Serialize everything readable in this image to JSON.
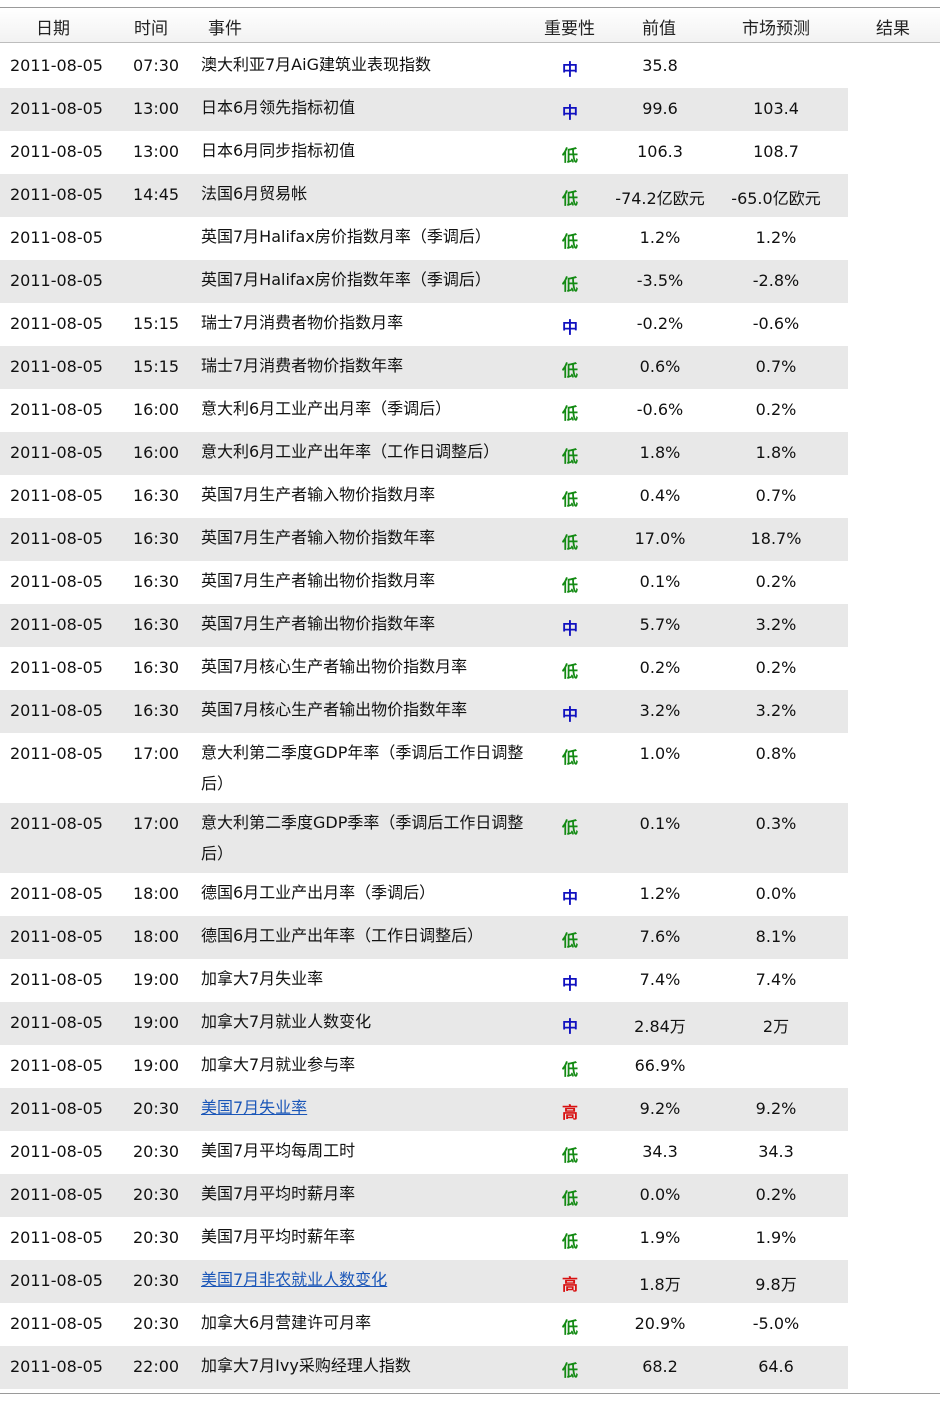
{
  "header": {
    "date": "日期",
    "time": "时间",
    "event": "事件",
    "importance": "重要性",
    "previous": "前值",
    "forecast": "市场预测",
    "result": "结果"
  },
  "colors": {
    "mid": "#1010c0",
    "low": "#138a13",
    "high": "#d81010",
    "link": "#1a56b8",
    "alt_row": "#e8e8e8"
  },
  "rows": [
    {
      "date": "2011-08-05",
      "time": "07:30",
      "event": "澳大利亚7月AiG建筑业表现指数",
      "importance": "中",
      "previous": "35.8",
      "forecast": ""
    },
    {
      "date": "2011-08-05",
      "time": "13:00",
      "event": "日本6月领先指标初值",
      "importance": "中",
      "previous": "99.6",
      "forecast": "103.4"
    },
    {
      "date": "2011-08-05",
      "time": "13:00",
      "event": "日本6月同步指标初值",
      "importance": "低",
      "previous": "106.3",
      "forecast": "108.7"
    },
    {
      "date": "2011-08-05",
      "time": "14:45",
      "event": "法国6月贸易帐",
      "importance": "低",
      "previous": "-74.2亿欧元",
      "forecast": "-65.0亿欧元"
    },
    {
      "date": "2011-08-05",
      "time": "",
      "event": "英国7月Halifax房价指数月率（季调后）",
      "importance": "低",
      "previous": "1.2%",
      "forecast": "1.2%"
    },
    {
      "date": "2011-08-05",
      "time": "",
      "event": "英国7月Halifax房价指数年率（季调后）",
      "importance": "低",
      "previous": "-3.5%",
      "forecast": "-2.8%"
    },
    {
      "date": "2011-08-05",
      "time": "15:15",
      "event": "瑞士7月消费者物价指数月率",
      "importance": "中",
      "previous": "-0.2%",
      "forecast": "-0.6%"
    },
    {
      "date": "2011-08-05",
      "time": "15:15",
      "event": "瑞士7月消费者物价指数年率",
      "importance": "低",
      "previous": "0.6%",
      "forecast": "0.7%"
    },
    {
      "date": "2011-08-05",
      "time": "16:00",
      "event": "意大利6月工业产出月率（季调后）",
      "importance": "低",
      "previous": "-0.6%",
      "forecast": "0.2%"
    },
    {
      "date": "2011-08-05",
      "time": "16:00",
      "event": "意大利6月工业产出年率（工作日调整后）",
      "importance": "低",
      "previous": "1.8%",
      "forecast": "1.8%"
    },
    {
      "date": "2011-08-05",
      "time": "16:30",
      "event": "英国7月生产者输入物价指数月率",
      "importance": "低",
      "previous": "0.4%",
      "forecast": "0.7%"
    },
    {
      "date": "2011-08-05",
      "time": "16:30",
      "event": "英国7月生产者输入物价指数年率",
      "importance": "低",
      "previous": "17.0%",
      "forecast": "18.7%"
    },
    {
      "date": "2011-08-05",
      "time": "16:30",
      "event": "英国7月生产者输出物价指数月率",
      "importance": "低",
      "previous": "0.1%",
      "forecast": "0.2%"
    },
    {
      "date": "2011-08-05",
      "time": "16:30",
      "event": "英国7月生产者输出物价指数年率",
      "importance": "中",
      "previous": "5.7%",
      "forecast": "3.2%"
    },
    {
      "date": "2011-08-05",
      "time": "16:30",
      "event": "英国7月核心生产者输出物价指数月率",
      "importance": "低",
      "previous": "0.2%",
      "forecast": "0.2%"
    },
    {
      "date": "2011-08-05",
      "time": "16:30",
      "event": "英国7月核心生产者输出物价指数年率",
      "importance": "中",
      "previous": "3.2%",
      "forecast": "3.2%"
    },
    {
      "date": "2011-08-05",
      "time": "17:00",
      "event": "意大利第二季度GDP年率（季调后工作日调整后）",
      "importance": "低",
      "previous": "1.0%",
      "forecast": "0.8%"
    },
    {
      "date": "2011-08-05",
      "time": "17:00",
      "event": "意大利第二季度GDP季率（季调后工作日调整后）",
      "importance": "低",
      "previous": "0.1%",
      "forecast": "0.3%"
    },
    {
      "date": "2011-08-05",
      "time": "18:00",
      "event": "德国6月工业产出月率（季调后）",
      "importance": "中",
      "previous": "1.2%",
      "forecast": "0.0%"
    },
    {
      "date": "2011-08-05",
      "time": "18:00",
      "event": "德国6月工业产出年率（工作日调整后）",
      "importance": "低",
      "previous": "7.6%",
      "forecast": "8.1%"
    },
    {
      "date": "2011-08-05",
      "time": "19:00",
      "event": "加拿大7月失业率",
      "importance": "中",
      "previous": "7.4%",
      "forecast": "7.4%"
    },
    {
      "date": "2011-08-05",
      "time": "19:00",
      "event": "加拿大7月就业人数变化",
      "importance": "中",
      "previous": "2.84万",
      "forecast": "2万"
    },
    {
      "date": "2011-08-05",
      "time": "19:00",
      "event": "加拿大7月就业参与率",
      "importance": "低",
      "previous": "66.9%",
      "forecast": ""
    },
    {
      "date": "2011-08-05",
      "time": "20:30",
      "event": "美国7月失业率",
      "importance": "高",
      "previous": "9.2%",
      "forecast": "9.2%"
    },
    {
      "date": "2011-08-05",
      "time": "20:30",
      "event": "美国7月平均每周工时",
      "importance": "低",
      "previous": "34.3",
      "forecast": "34.3"
    },
    {
      "date": "2011-08-05",
      "time": "20:30",
      "event": "美国7月平均时薪月率",
      "importance": "低",
      "previous": "0.0%",
      "forecast": "0.2%"
    },
    {
      "date": "2011-08-05",
      "time": "20:30",
      "event": "美国7月平均时薪年率",
      "importance": "低",
      "previous": "1.9%",
      "forecast": "1.9%"
    },
    {
      "date": "2011-08-05",
      "time": "20:30",
      "event": "美国7月非农就业人数变化",
      "importance": "高",
      "previous": "1.8万",
      "forecast": "9.8万"
    },
    {
      "date": "2011-08-05",
      "time": "20:30",
      "event": "加拿大6月营建许可月率",
      "importance": "低",
      "previous": "20.9%",
      "forecast": "-5.0%"
    },
    {
      "date": "2011-08-05",
      "time": "22:00",
      "event": "加拿大7月Ivy采购经理人指数",
      "importance": "低",
      "previous": "68.2",
      "forecast": "64.6"
    }
  ]
}
